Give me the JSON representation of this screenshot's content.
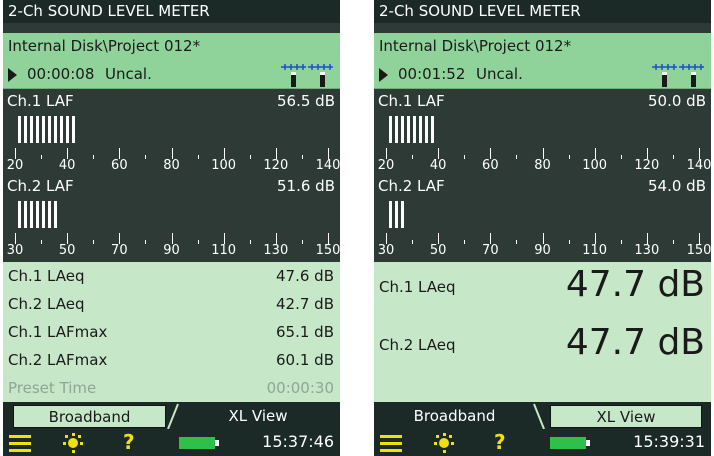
{
  "colors": {
    "title_bg": "#1c2a27",
    "green_header": "#8fd39a",
    "meter_bg": "#2d3a35",
    "panel_bg": "#c7e7c9",
    "accent_yellow": "#f1e010",
    "battery_green": "#2fc04a"
  },
  "icons": {
    "menu": "menu-icon",
    "backlight": "backlight-bulb-icon",
    "help": "help-question-icon",
    "battery": "battery-icon",
    "play": "play-icon",
    "mics": "microphone-input-icon"
  },
  "left": {
    "title": "2-Ch SOUND LEVEL METER",
    "path": "Internal Disk\\Project 012*",
    "elapsed": "00:00:08",
    "cal": "Uncal.",
    "ch1": {
      "name": "Ch.1 LAF",
      "value": "56.5 dB",
      "bar_count": 10,
      "ticks": [
        "20",
        "40",
        "60",
        "80",
        "100",
        "120",
        "140"
      ]
    },
    "ch2": {
      "name": "Ch.2 LAF",
      "value": "51.6 dB",
      "bar_count": 7,
      "ticks": [
        "30",
        "50",
        "70",
        "90",
        "110",
        "130",
        "150"
      ]
    },
    "rows": [
      {
        "label": "Ch.1 LAeq",
        "value": "47.6 dB"
      },
      {
        "label": "Ch.2 LAeq",
        "value": "42.7 dB"
      },
      {
        "label": "Ch.1 LAFmax",
        "value": "65.1 dB"
      },
      {
        "label": "Ch.2 LAFmax",
        "value": "60.1 dB"
      },
      {
        "label": "Preset Time",
        "value": "00:00:30"
      }
    ],
    "tabs": {
      "first": "Broadband",
      "second": "XL View"
    },
    "clock": "15:37:46"
  },
  "right": {
    "title": "2-Ch SOUND LEVEL METER",
    "path": "Internal Disk\\Project 012*",
    "elapsed": "00:01:52",
    "cal": "Uncal.",
    "ch1": {
      "name": "Ch.1 LAF",
      "value": "50.0 dB",
      "bar_count": 8,
      "ticks": [
        "20",
        "40",
        "60",
        "80",
        "100",
        "120",
        "140"
      ]
    },
    "ch2": {
      "name": "Ch.2 LAF",
      "value": "54.0 dB",
      "bar_count": 3,
      "ticks": [
        "30",
        "50",
        "70",
        "90",
        "110",
        "130",
        "150"
      ]
    },
    "big": [
      {
        "label": "Ch.1 LAeq",
        "value": "47.7 dB"
      },
      {
        "label": "Ch.2 LAeq",
        "value": "47.7 dB"
      }
    ],
    "tabs": {
      "first": "Broadband",
      "second": "XL View"
    },
    "clock": "15:39:31"
  }
}
